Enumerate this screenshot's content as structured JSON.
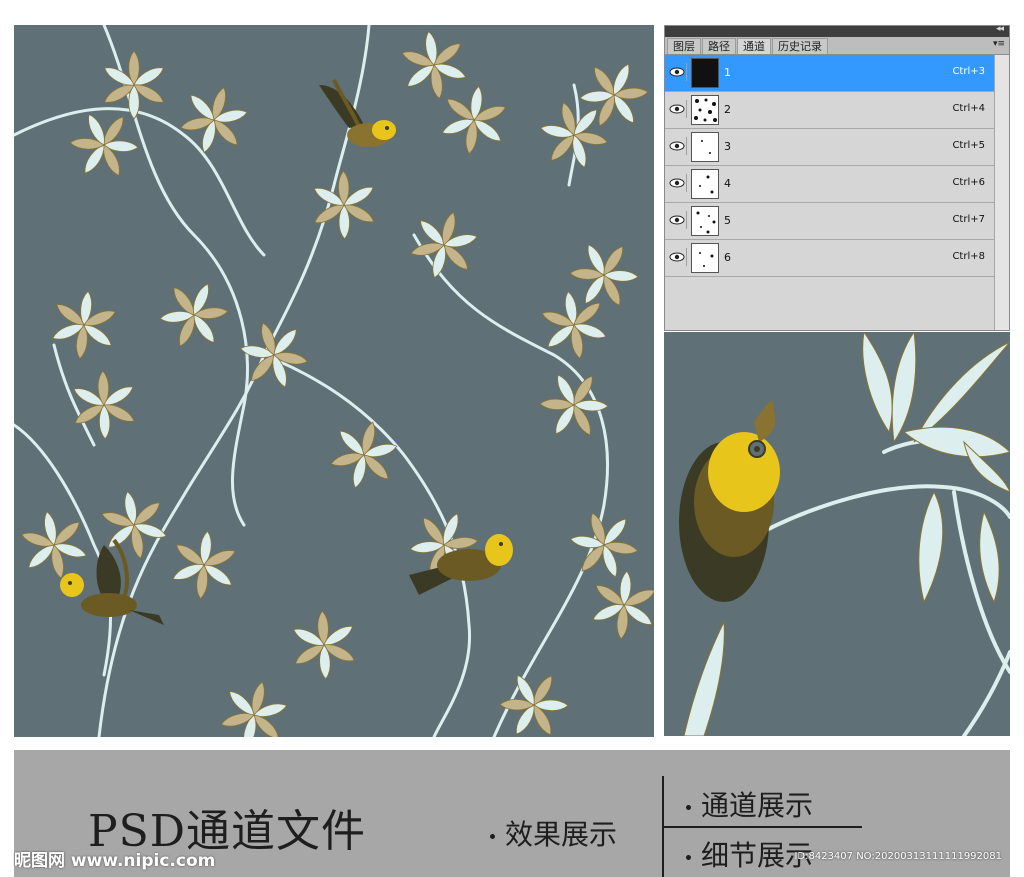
{
  "colors": {
    "background": "#5f7076",
    "leaf_light": "#dcefee",
    "leaf_tan": "#c4b48b",
    "leaf_olive": "#8a7330",
    "bird_yellow": "#e8c51a",
    "bird_dark": "#3b3a25",
    "panel_bg": "#d6d6d6",
    "panel_selected": "#3399ff",
    "footer_bg": "#a7a7a7"
  },
  "channels_panel": {
    "tabs": [
      {
        "label": "图层"
      },
      {
        "label": "路径"
      },
      {
        "label": "通道"
      },
      {
        "label": "历史记录"
      }
    ],
    "active_tab": "通道",
    "channels": [
      {
        "name": "1",
        "shortcut": "Ctrl+3"
      },
      {
        "name": "2",
        "shortcut": "Ctrl+4"
      },
      {
        "name": "3",
        "shortcut": "Ctrl+5"
      },
      {
        "name": "4",
        "shortcut": "Ctrl+6"
      },
      {
        "name": "5",
        "shortcut": "Ctrl+7"
      },
      {
        "name": "6",
        "shortcut": "Ctrl+8"
      }
    ],
    "selected_channel": "1"
  },
  "footer": {
    "title": "PSD通道文件",
    "effect_label": "效果展示",
    "channel_label": "通道展示",
    "detail_label": "细节展示"
  },
  "watermark": {
    "site": "昵图网 www.nipic.com",
    "id_text": "ID:8423407 NO:20200313111111992081"
  }
}
